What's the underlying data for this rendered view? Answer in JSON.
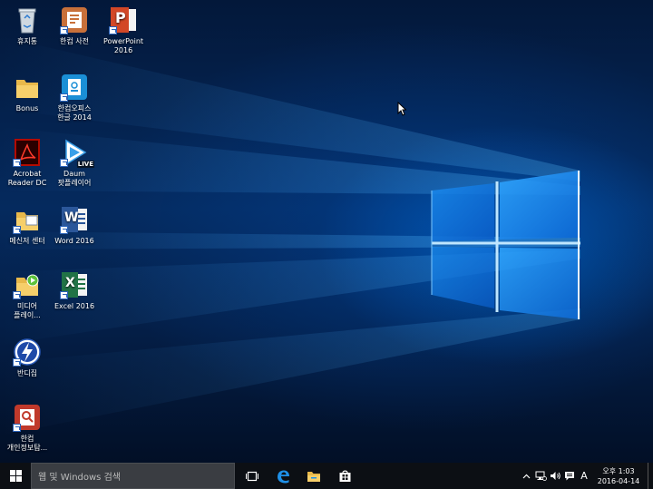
{
  "desktop": {
    "icons": [
      {
        "id": "recycle-bin",
        "label": "휴지통"
      },
      {
        "id": "hancom-dictionary",
        "label": "한컴 사전"
      },
      {
        "id": "powerpoint-2016",
        "label": "PowerPoint\n2016"
      },
      {
        "id": "bonus-folder",
        "label": "Bonus"
      },
      {
        "id": "hancom-office-hangul-2014",
        "label": "한컴오피스\n한글 2014"
      },
      {
        "id": "acrobat-reader-dc",
        "label": "Acrobat\nReader DC"
      },
      {
        "id": "daum-potplayer",
        "label": "Daum\n팟플레이어"
      },
      {
        "id": "messenger-center",
        "label": "메신저 센터"
      },
      {
        "id": "word-2016",
        "label": "Word 2016"
      },
      {
        "id": "media-player",
        "label": "미디어\n플레이..."
      },
      {
        "id": "excel-2016",
        "label": "Excel 2016"
      },
      {
        "id": "bandizip",
        "label": "반디집"
      },
      {
        "id": "hancom-privacy",
        "label": "한컴\n개인정보탐..."
      }
    ],
    "badges": {
      "live": "LIVE",
      "word_letter": "W",
      "excel_letter": "X",
      "ppt_letter": "P"
    }
  },
  "taskbar": {
    "search_placeholder": "웹 및 Windows 검색",
    "apps": [
      "task-view",
      "edge",
      "file-explorer",
      "store"
    ],
    "tray": {
      "ime": "A",
      "clock_ampm_time": "오후 1:03",
      "clock_date": "2016-04-14"
    }
  },
  "colors": {
    "accent": "#0078d7",
    "taskbar": "#0c0f14",
    "search_box": "#3a3d42",
    "word": "#2b579a",
    "excel": "#217346",
    "powerpoint": "#d24726",
    "acrobat": "#b30b00",
    "hancom_orange": "#c8703a"
  }
}
